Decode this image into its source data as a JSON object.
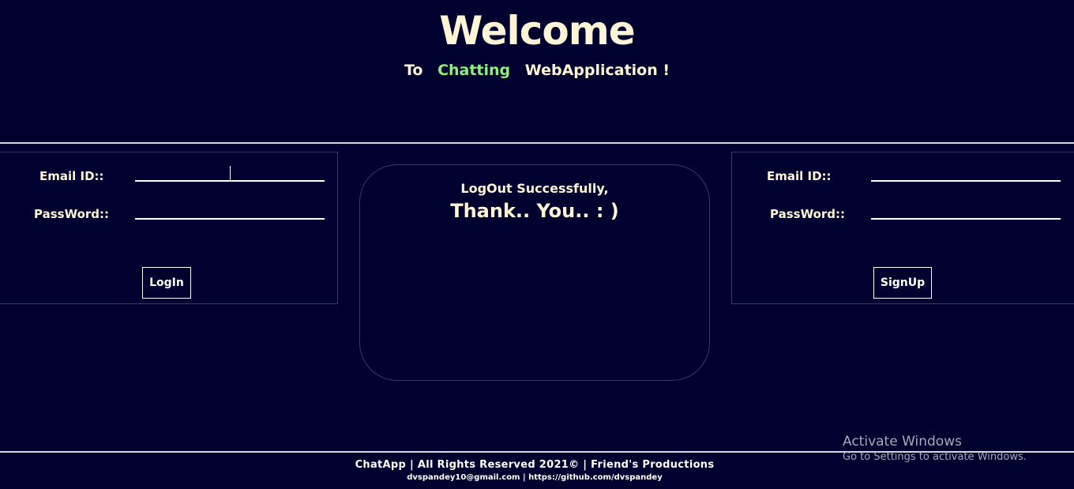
{
  "header": {
    "title": "Welcome",
    "subtitle_prefix": "To",
    "subtitle_accent": "Chatting",
    "subtitle_suffix": "WebApplication !"
  },
  "login_panel": {
    "email_label": "Email ID::",
    "email_value": "",
    "password_label": "PassWord::",
    "password_value": "",
    "button_label": "LogIn"
  },
  "signup_panel": {
    "email_label": "Email ID::",
    "email_value": "",
    "password_label": "PassWord::",
    "password_value": "",
    "button_label": "SignUp"
  },
  "message": {
    "line1": "LogOut Successfully,",
    "line2": "Thank.. You.. : )"
  },
  "footer": {
    "main": "ChatApp | All Rights Reserved 2021© | Friend's Productions",
    "sub": "dvspandey10@gmail.com | https://github.com/dvspandey"
  },
  "watermark": {
    "line1": "Activate Windows",
    "line2": "Go to Settings to activate Windows."
  },
  "colors": {
    "background": "#01012f",
    "text": "#fff5d6",
    "accent": "#8cf07a"
  }
}
